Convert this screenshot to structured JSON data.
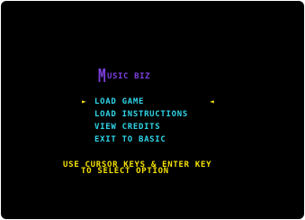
{
  "game": {
    "title_initial": "M",
    "title_rest": "USIC BIZ"
  },
  "menu": {
    "selector_left": "►",
    "selector_right": "◄",
    "items": [
      {
        "label": "LOAD GAME",
        "selected": true
      },
      {
        "label": "LOAD INSTRUCTIONS",
        "selected": false
      },
      {
        "label": "VIEW CREDITS",
        "selected": false
      },
      {
        "label": "EXIT TO BASIC",
        "selected": false
      }
    ]
  },
  "help": {
    "line1": "USE CURSOR KEYS & ENTER KEY",
    "line2": "TO SELECT OPTION"
  },
  "colors": {
    "background": "#000000",
    "title": "#7d3fe0",
    "menu_text": "#2fd5e8",
    "selector_and_help": "#f5e000"
  }
}
